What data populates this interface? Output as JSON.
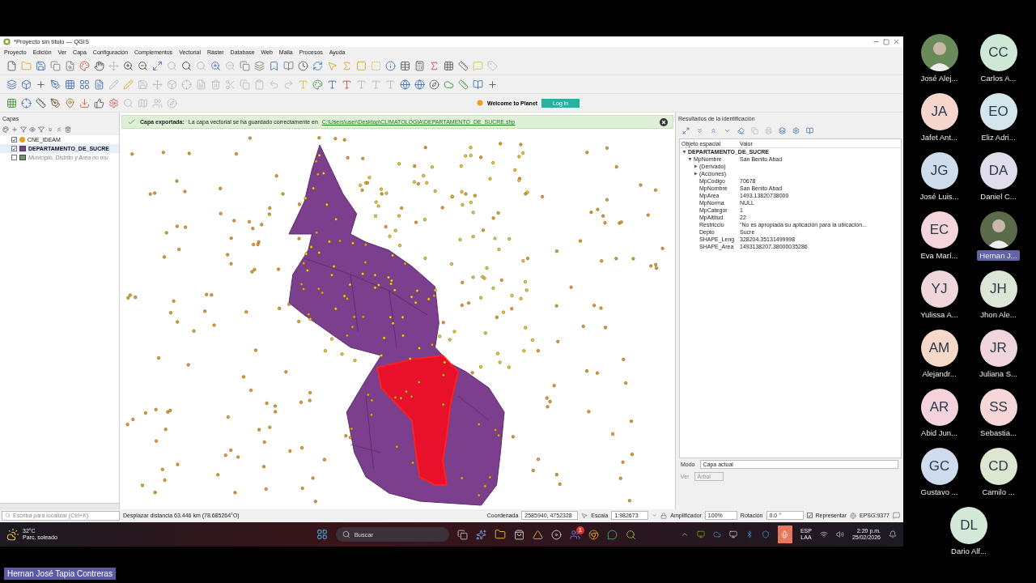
{
  "window": {
    "title": "*Proyecto sin título — QGIS"
  },
  "menu": [
    "Proyecto",
    "Edición",
    "Ver",
    "Capa",
    "Configuración",
    "Complementos",
    "Vectorial",
    "Ráster",
    "Database",
    "Web",
    "Malla",
    "Procesos",
    "Ayuda"
  ],
  "planet": {
    "welcome": "Welcome to Planet",
    "login": "Log in"
  },
  "message": {
    "title": "Capa exportada:",
    "text": "La capa vectorial se ha guardado correctamente en",
    "link": "C:\\Users\\user\\Desktop\\CLIMATOLOGIA\\DEPARTAMENTO_DE_SUCRE.shp"
  },
  "layers": {
    "title": "Capas",
    "items": [
      {
        "name": "CNE_IDEAM",
        "checked": true,
        "selected": false,
        "disabled": false,
        "color": "#e8a020"
      },
      {
        "name": "DEPARTAMENTO_DE_SUCRE",
        "checked": true,
        "selected": true,
        "disabled": false,
        "color": "#7b3f8e"
      },
      {
        "name": "Municipio, Distrito y Area no mu",
        "checked": false,
        "selected": false,
        "disabled": true,
        "color": "#6a9a6a"
      }
    ],
    "search_placeholder": "Escriba para localizar (Ctrl+K)"
  },
  "identify": {
    "title": "Resultados de la identificación",
    "columns": [
      "Objeto espacial",
      "Valor"
    ],
    "tree": [
      {
        "field": "DEPARTAMENTO_DE_SUCRE",
        "expanded": true,
        "children": [
          {
            "field": "MpNombre",
            "value": "San Benito Abad",
            "expanded": true,
            "children": [
              {
                "field": "(Derivado)",
                "expanded": false
              },
              {
                "field": "(Acciones)",
                "expanded": false
              },
              {
                "field": "MpCodigo",
                "value": "70678"
              },
              {
                "field": "MpNombre",
                "value": "San Benito Abad"
              },
              {
                "field": "MpArea",
                "value": "1493.13820738000"
              },
              {
                "field": "MpNorma",
                "value": "NULL"
              },
              {
                "field": "MpCategor",
                "value": "1"
              },
              {
                "field": "MpAltitud",
                "value": "22"
              },
              {
                "field": "Restriccio",
                "value": "\"No es apropiada su aplicación para la ubicación..."
              },
              {
                "field": "Depto",
                "value": "Sucre"
              },
              {
                "field": "SHAPE_Leng",
                "value": "328204.35131499998"
              },
              {
                "field": "SHAPE_Area",
                "value": "1493138207.38000035286"
              }
            ]
          }
        ]
      }
    ],
    "mode_label": "Modo",
    "mode_value": "Capa actual",
    "view_label": "Ver",
    "view_value": "Árbol"
  },
  "status": {
    "message": "Desplazar distancia 63.446 km (78.685264°O)",
    "coord_label": "Coordenada",
    "coord": "2585940, 4752328",
    "scale_label": "Escala",
    "scale": "1:982673",
    "magnifier_label": "Amplificador",
    "magnifier": "100%",
    "rotation_label": "Rotación",
    "rotation": "0.0 °",
    "render_label": "Representar",
    "render": true,
    "crs": "EPSG:9377"
  },
  "taskbar": {
    "temperature": "32°C",
    "weather": "Parc. soleado",
    "search": "Buscar",
    "badge": "1",
    "lang": "ESP",
    "layout": "LAA",
    "time": "2:20 p.m.",
    "date": "25/02/2026"
  },
  "presenter": "Hernan José Tapia Contreras",
  "participants": [
    {
      "name": "José Alej...",
      "kind": "photo",
      "selected": false,
      "color": "#6a8a5a"
    },
    {
      "initials": "CC",
      "name": "Carlos A...",
      "kind": "initials",
      "selected": false,
      "color": "#cfe8d6"
    },
    {
      "initials": "JA",
      "name": "Jafet Ant...",
      "kind": "initials",
      "selected": false,
      "color": "#f6d6cc"
    },
    {
      "initials": "EO",
      "name": "Eliz Adri...",
      "kind": "initials",
      "selected": false,
      "color": "#d4e6ec"
    },
    {
      "initials": "JG",
      "name": "José Luis...",
      "kind": "initials",
      "selected": false,
      "color": "#cfdcec"
    },
    {
      "initials": "DA",
      "name": "Daniel C...",
      "kind": "initials",
      "selected": false,
      "color": "#e0dcec"
    },
    {
      "initials": "EC",
      "name": "Eva Marí...",
      "kind": "initials",
      "selected": false,
      "color": "#f5d4dc"
    },
    {
      "name": "Hernan J...",
      "kind": "photo",
      "selected": true,
      "color": "#5a6a4a"
    },
    {
      "initials": "YJ",
      "name": "Yulissa A...",
      "kind": "initials",
      "selected": false,
      "color": "#eed6da"
    },
    {
      "initials": "JH",
      "name": "Jhon Ale...",
      "kind": "initials",
      "selected": false,
      "color": "#dce6d6"
    },
    {
      "initials": "AM",
      "name": "Alejandr...",
      "kind": "initials",
      "selected": false,
      "color": "#f6d8c8"
    },
    {
      "initials": "JR",
      "name": "Juliana S...",
      "kind": "initials",
      "selected": false,
      "color": "#f0d6dc"
    },
    {
      "initials": "AR",
      "name": "Abid Jun...",
      "kind": "initials",
      "selected": false,
      "color": "#f6d2dc"
    },
    {
      "initials": "SS",
      "name": "Sebastia...",
      "kind": "initials",
      "selected": false,
      "color": "#f6d6d6"
    },
    {
      "initials": "GC",
      "name": "Gustavo ...",
      "kind": "initials",
      "selected": false,
      "color": "#cfdcee"
    },
    {
      "initials": "CD",
      "name": "Camilo ...",
      "kind": "initials",
      "selected": false,
      "color": "#dce6d0"
    },
    {
      "initials": "DL",
      "name": "Dario Alf...",
      "kind": "initials",
      "selected": false,
      "color": "#d4e8d8"
    }
  ]
}
